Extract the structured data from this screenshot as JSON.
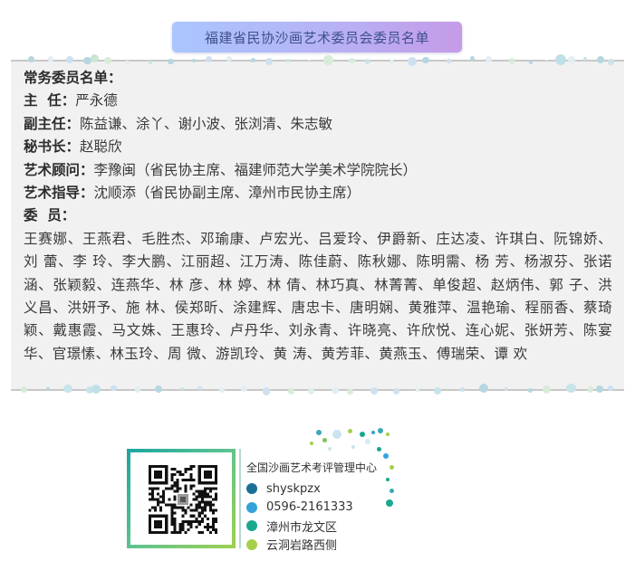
{
  "title": "福建省民协沙画艺术委员会委员名单",
  "standing": {
    "heading": "常务委员名单：",
    "rows": [
      {
        "label": "主  任：",
        "value": "严永德"
      },
      {
        "label": "副主任：",
        "value": "陈益谦、涂丫、谢小波、张浏清、朱志敏"
      },
      {
        "label": "秘书长：",
        "value": "赵聪欣"
      },
      {
        "label": "艺术顾问：",
        "value": "李豫闽（省民协主席、福建师范大学美术学院院长）"
      },
      {
        "label": "艺术指导：",
        "value": "沈顺添（省民协副主席、漳州市民协主席）"
      }
    ]
  },
  "members": {
    "label": "委  员：",
    "text": "王赛娜、王燕君、毛胜杰、邓瑜康、卢宏光、吕爱玲、伊爵新、庄达凌、许琪白、阮锦娇、刘 蕾、李 玲、李大鹏、江丽超、江万涛、陈佳蔚、陈秋娜、陈明需、杨 芳、杨淑芬、张诺涵、张颖毅、连燕华、林 彦、林 婷、林 倩、林巧真、林菁菁、单俊超、赵炳伟、郭 子、洪义昌、洪妍予、施 林、侯郑昕、涂建辉、唐忠卡、唐明娴、黄雅萍、温艳瑜、程丽香、蔡琦颖、戴惠霞、马文姝、王惠玲、卢丹华、刘永青、许晓亮、许欣悦、连心妮、张妍芳、陈宴华、官璟愫、林玉玲、周 微、游凯玲、黄 涛、黄芳菲、黄燕玉、傅瑞荣、谭 欢"
  },
  "footer": {
    "org": "全国沙画艺术考评管理中心",
    "contacts": [
      {
        "icon": "wechat-dot-icon",
        "color": "#1a6f97",
        "text": "shyskpzx"
      },
      {
        "icon": "phone-dot-icon",
        "color": "#33a3d8",
        "text": "0596-2161333"
      },
      {
        "icon": "location-dot-icon",
        "color": "#1aa88e",
        "text": "漳州市龙文区"
      },
      {
        "icon": "address-dot-icon",
        "color": "#a6cf4c",
        "text": "云洞岩路西侧"
      }
    ]
  }
}
